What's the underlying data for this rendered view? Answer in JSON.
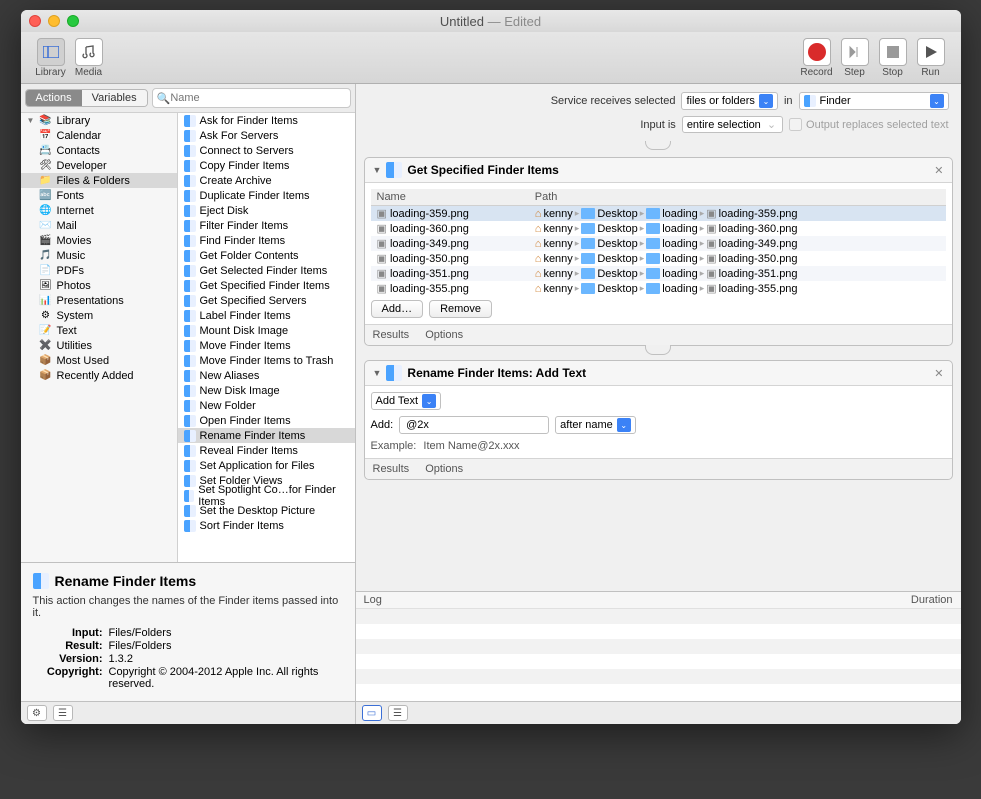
{
  "title": "Untitled",
  "titleSuffix": "— Edited",
  "toolbar": {
    "library": "Library",
    "media": "Media",
    "record": "Record",
    "step": "Step",
    "stop": "Stop",
    "run": "Run"
  },
  "sidebar": {
    "tabs": {
      "actions": "Actions",
      "variables": "Variables"
    },
    "searchPlaceholder": "Name",
    "categories": [
      "Library",
      "Calendar",
      "Contacts",
      "Developer",
      "Files & Folders",
      "Fonts",
      "Internet",
      "Mail",
      "Movies",
      "Music",
      "PDFs",
      "Photos",
      "Presentations",
      "System",
      "Text",
      "Utilities",
      "Most Used",
      "Recently Added"
    ],
    "selectedCategory": "Files & Folders",
    "actions": [
      "Ask for Finder Items",
      "Ask For Servers",
      "Connect to Servers",
      "Copy Finder Items",
      "Create Archive",
      "Duplicate Finder Items",
      "Eject Disk",
      "Filter Finder Items",
      "Find Finder Items",
      "Get Folder Contents",
      "Get Selected Finder Items",
      "Get Specified Finder Items",
      "Get Specified Servers",
      "Label Finder Items",
      "Mount Disk Image",
      "Move Finder Items",
      "Move Finder Items to Trash",
      "New Aliases",
      "New Disk Image",
      "New Folder",
      "Open Finder Items",
      "Rename Finder Items",
      "Reveal Finder Items",
      "Set Application for Files",
      "Set Folder Views",
      "Set Spotlight Co…for Finder Items",
      "Set the Desktop Picture",
      "Sort Finder Items"
    ],
    "selectedAction": "Rename Finder Items"
  },
  "info": {
    "title": "Rename Finder Items",
    "desc": "This action changes the names of the Finder items passed into it.",
    "fields": {
      "Input": "Files/Folders",
      "Result": "Files/Folders",
      "Version": "1.3.2",
      "Copyright": "Copyright © 2004-2012 Apple Inc.  All rights reserved."
    }
  },
  "config": {
    "svcLabel": "Service receives selected",
    "svcValue": "files or folders",
    "inLabel": "in",
    "appValue": "Finder",
    "inputIsLabel": "Input is",
    "inputIsValue": "entire selection",
    "replaceLabel": "Output replaces selected text"
  },
  "action1": {
    "title": "Get Specified Finder Items",
    "cols": {
      "name": "Name",
      "path": "Path"
    },
    "files": [
      {
        "name": "loading-359.png",
        "p": [
          "kenny",
          "Desktop",
          "loading",
          "loading-359.png"
        ]
      },
      {
        "name": "loading-360.png",
        "p": [
          "kenny",
          "Desktop",
          "loading",
          "loading-360.png"
        ]
      },
      {
        "name": "loading-349.png",
        "p": [
          "kenny",
          "Desktop",
          "loading",
          "loading-349.png"
        ]
      },
      {
        "name": "loading-350.png",
        "p": [
          "kenny",
          "Desktop",
          "loading",
          "loading-350.png"
        ]
      },
      {
        "name": "loading-351.png",
        "p": [
          "kenny",
          "Desktop",
          "loading",
          "loading-351.png"
        ]
      },
      {
        "name": "loading-355.png",
        "p": [
          "kenny",
          "Desktop",
          "loading",
          "loading-355.png"
        ]
      }
    ],
    "addBtn": "Add…",
    "removeBtn": "Remove",
    "results": "Results",
    "options": "Options"
  },
  "action2": {
    "title": "Rename Finder Items: Add Text",
    "mode": "Add Text",
    "addLabel": "Add:",
    "addValue": "@2x",
    "position": "after name",
    "exampleLabel": "Example:",
    "exampleValue": "Item Name@2x.xxx",
    "results": "Results",
    "options": "Options"
  },
  "log": {
    "log": "Log",
    "duration": "Duration"
  }
}
